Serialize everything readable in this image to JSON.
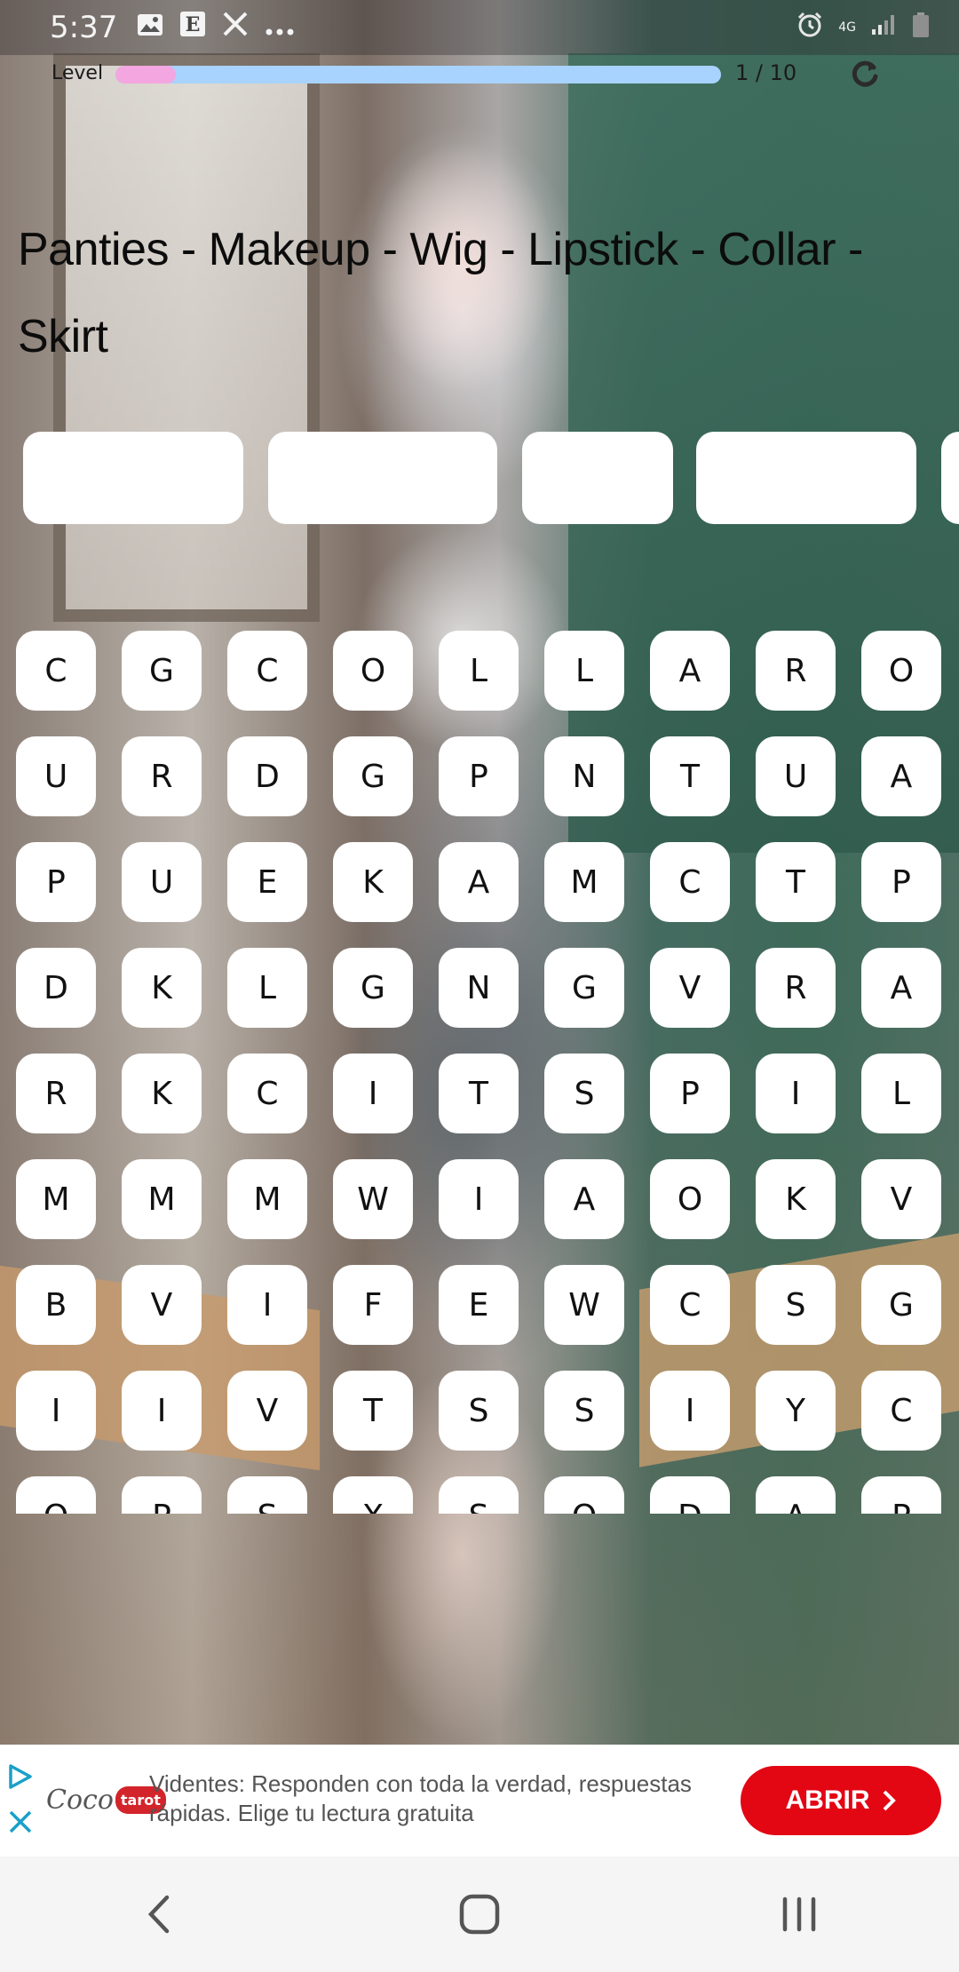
{
  "status_bar": {
    "time": "5:37",
    "icons": [
      "gallery-icon",
      "e-app-icon",
      "x-app-icon",
      "more-dots-icon"
    ],
    "right_icons": [
      "alarm-icon",
      "network-4g-icon",
      "signal-icon",
      "battery-icon"
    ],
    "network_label": "4G"
  },
  "level": {
    "label": "Level",
    "count": "1 / 10",
    "progress": 0.1,
    "colors": {
      "fill": "#f3a6e0",
      "track": "#a8d3ff"
    }
  },
  "words": {
    "title": "Panties - Makeup - Wig - Lipstick - Collar - Skirt"
  },
  "slots": {
    "count_visible": 5
  },
  "grid": {
    "rows": [
      [
        "C",
        "G",
        "C",
        "O",
        "L",
        "L",
        "A",
        "R",
        "O"
      ],
      [
        "U",
        "R",
        "D",
        "G",
        "P",
        "N",
        "T",
        "U",
        "A"
      ],
      [
        "P",
        "U",
        "E",
        "K",
        "A",
        "M",
        "C",
        "T",
        "P"
      ],
      [
        "D",
        "K",
        "L",
        "G",
        "N",
        "G",
        "V",
        "R",
        "A"
      ],
      [
        "R",
        "K",
        "C",
        "I",
        "T",
        "S",
        "P",
        "I",
        "L"
      ],
      [
        "M",
        "M",
        "M",
        "W",
        "I",
        "A",
        "O",
        "K",
        "V"
      ],
      [
        "B",
        "V",
        "I",
        "F",
        "E",
        "W",
        "C",
        "S",
        "G"
      ],
      [
        "I",
        "I",
        "V",
        "T",
        "S",
        "S",
        "I",
        "Y",
        "C"
      ],
      [
        "O",
        "P",
        "S",
        "X",
        "S",
        "O",
        "D",
        "A",
        "P"
      ]
    ]
  },
  "ad": {
    "brand": "Coco",
    "brand_badge": "tarot",
    "text": "Videntes: Responden con toda la verdad, respuestas rápidas. Elige tu lectura gratuita",
    "button_label": "ABRIR",
    "button_color": "#e30613"
  },
  "nav": {
    "back": "back-icon",
    "home": "home-icon",
    "recents": "recents-icon"
  }
}
